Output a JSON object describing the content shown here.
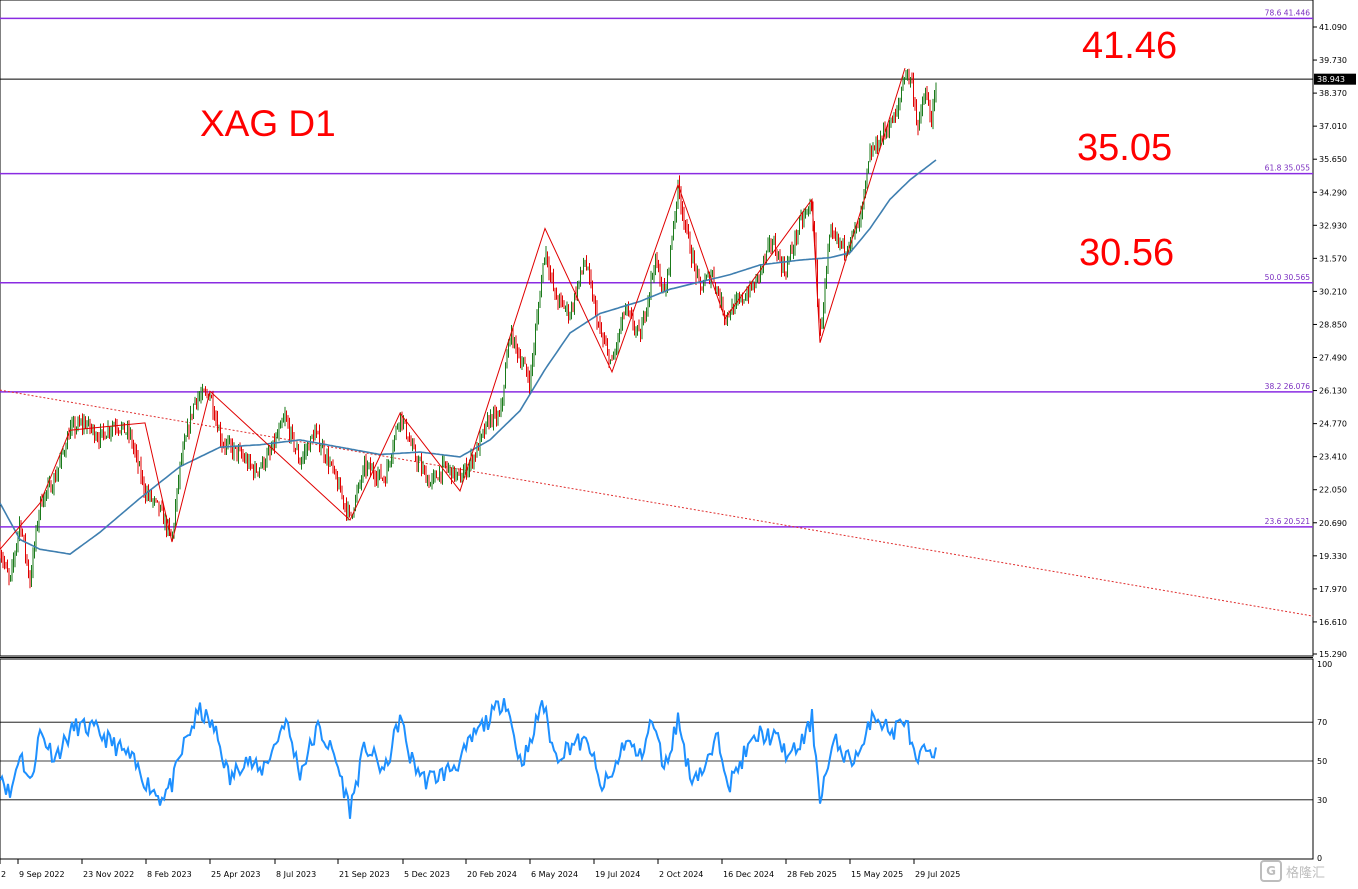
{
  "chart_data": [
    {
      "type": "candlestick",
      "symbol_label": "XAG D1",
      "y_range": [
        15.29,
        42.0
      ],
      "y_ticks": [
        "41.090",
        "39.730",
        "38.370",
        "37.010",
        "35.650",
        "34.290",
        "32.930",
        "31.570",
        "30.210",
        "28.850",
        "27.490",
        "26.130",
        "24.770",
        "23.410",
        "22.050",
        "20.690",
        "19.330",
        "17.970",
        "16.610",
        "15.290"
      ],
      "x_ticks": [
        "2",
        "9 Sep 2022",
        "23 Nov 2022",
        "8 Feb 2023",
        "25 Apr 2023",
        "8 Jul 2023",
        "21 Sep 2023",
        "5 Dec 2023",
        "20 Feb 2024",
        "6 May 2024",
        "19 Jul 2024",
        "2 Oct 2024",
        "16 Dec 2024",
        "28 Feb 2025",
        "15 May 2025",
        "29 Jul 2025"
      ],
      "current_price": "38.943",
      "fib_levels": [
        {
          "label": "78.6 41.446",
          "value": 41.446
        },
        {
          "label": "61.8 35.055",
          "value": 35.055
        },
        {
          "label": "50.0 30.565",
          "value": 30.565
        },
        {
          "label": "38.2 26.076",
          "value": 26.076
        },
        {
          "label": "23.6 20.521",
          "value": 20.521
        }
      ],
      "annotations": [
        "41.46",
        "35.05",
        "30.56"
      ],
      "price_anchors": [
        [
          0,
          19.6
        ],
        [
          10,
          18.2
        ],
        [
          20,
          20.8
        ],
        [
          30,
          18.3
        ],
        [
          40,
          21.5
        ],
        [
          55,
          22.5
        ],
        [
          70,
          24.5
        ],
        [
          85,
          24.8
        ],
        [
          100,
          24.2
        ],
        [
          115,
          24.8
        ],
        [
          130,
          24.3
        ],
        [
          145,
          22.0
        ],
        [
          160,
          21.2
        ],
        [
          172,
          20.0
        ],
        [
          180,
          23.0
        ],
        [
          195,
          25.8
        ],
        [
          210,
          26.0
        ],
        [
          222,
          24.0
        ],
        [
          240,
          23.5
        ],
        [
          255,
          22.8
        ],
        [
          270,
          23.5
        ],
        [
          285,
          25.0
        ],
        [
          300,
          23.2
        ],
        [
          315,
          24.4
        ],
        [
          330,
          23.1
        ],
        [
          350,
          20.9
        ],
        [
          365,
          23.0
        ],
        [
          385,
          22.5
        ],
        [
          400,
          25.2
        ],
        [
          415,
          23.4
        ],
        [
          430,
          22.3
        ],
        [
          445,
          23.0
        ],
        [
          460,
          22.5
        ],
        [
          475,
          23.5
        ],
        [
          490,
          25.0
        ],
        [
          500,
          25.0
        ],
        [
          510,
          28.5
        ],
        [
          520,
          27.5
        ],
        [
          530,
          26.5
        ],
        [
          545,
          32.0
        ],
        [
          555,
          30.0
        ],
        [
          570,
          29.3
        ],
        [
          585,
          31.5
        ],
        [
          600,
          28.5
        ],
        [
          612,
          27.2
        ],
        [
          625,
          29.5
        ],
        [
          640,
          28.3
        ],
        [
          655,
          31.5
        ],
        [
          665,
          30.0
        ],
        [
          678,
          34.5
        ],
        [
          690,
          32.0
        ],
        [
          700,
          30.3
        ],
        [
          712,
          31.0
        ],
        [
          725,
          29.2
        ],
        [
          740,
          29.8
        ],
        [
          755,
          30.5
        ],
        [
          772,
          32.3
        ],
        [
          785,
          31.0
        ],
        [
          800,
          33.0
        ],
        [
          812,
          33.8
        ],
        [
          820,
          28.3
        ],
        [
          830,
          32.5
        ],
        [
          845,
          32.0
        ],
        [
          860,
          33.0
        ],
        [
          870,
          35.8
        ],
        [
          885,
          36.8
        ],
        [
          897,
          37.5
        ],
        [
          905,
          39.3
        ],
        [
          912,
          38.8
        ],
        [
          918,
          36.9
        ],
        [
          925,
          38.4
        ],
        [
          932,
          37.2
        ],
        [
          937,
          38.9
        ]
      ],
      "ma_anchors": [
        [
          0,
          21.5
        ],
        [
          20,
          20.0
        ],
        [
          40,
          19.6
        ],
        [
          70,
          19.4
        ],
        [
          100,
          20.3
        ],
        [
          140,
          21.7
        ],
        [
          180,
          23.0
        ],
        [
          220,
          23.8
        ],
        [
          260,
          23.9
        ],
        [
          300,
          24.1
        ],
        [
          340,
          23.8
        ],
        [
          380,
          23.5
        ],
        [
          420,
          23.6
        ],
        [
          460,
          23.4
        ],
        [
          490,
          24.1
        ],
        [
          520,
          25.3
        ],
        [
          545,
          27.0
        ],
        [
          570,
          28.5
        ],
        [
          600,
          29.3
        ],
        [
          640,
          29.8
        ],
        [
          670,
          30.3
        ],
        [
          700,
          30.6
        ],
        [
          730,
          30.9
        ],
        [
          760,
          31.3
        ],
        [
          800,
          31.5
        ],
        [
          830,
          31.6
        ],
        [
          850,
          31.8
        ],
        [
          870,
          32.8
        ],
        [
          890,
          34.0
        ],
        [
          910,
          34.8
        ],
        [
          937,
          35.65
        ]
      ],
      "trendline": {
        "start": 26.15,
        "end": 16.85,
        "style": "dotted"
      },
      "rsi": {
        "levels": [
          "70",
          "50",
          "30"
        ],
        "y_ticks": [
          "100",
          "0"
        ],
        "anchors": [
          [
            0,
            45
          ],
          [
            10,
            32
          ],
          [
            20,
            55
          ],
          [
            30,
            38
          ],
          [
            40,
            65
          ],
          [
            55,
            52
          ],
          [
            75,
            68
          ],
          [
            95,
            66
          ],
          [
            115,
            58
          ],
          [
            130,
            52
          ],
          [
            145,
            40
          ],
          [
            160,
            31
          ],
          [
            172,
            38
          ],
          [
            185,
            60
          ],
          [
            200,
            76
          ],
          [
            215,
            66
          ],
          [
            230,
            40
          ],
          [
            245,
            52
          ],
          [
            260,
            44
          ],
          [
            275,
            58
          ],
          [
            285,
            72
          ],
          [
            300,
            44
          ],
          [
            318,
            67
          ],
          [
            335,
            52
          ],
          [
            350,
            25
          ],
          [
            365,
            58
          ],
          [
            385,
            44
          ],
          [
            400,
            73
          ],
          [
            410,
            52
          ],
          [
            425,
            40
          ],
          [
            445,
            44
          ],
          [
            460,
            50
          ],
          [
            475,
            64
          ],
          [
            490,
            72
          ],
          [
            505,
            83
          ],
          [
            520,
            50
          ],
          [
            530,
            57
          ],
          [
            542,
            82
          ],
          [
            555,
            52
          ],
          [
            575,
            60
          ],
          [
            590,
            58
          ],
          [
            600,
            36
          ],
          [
            612,
            42
          ],
          [
            625,
            61
          ],
          [
            640,
            52
          ],
          [
            652,
            71
          ],
          [
            665,
            46
          ],
          [
            678,
            72
          ],
          [
            690,
            42
          ],
          [
            705,
            46
          ],
          [
            718,
            62
          ],
          [
            730,
            38
          ],
          [
            745,
            54
          ],
          [
            760,
            64
          ],
          [
            775,
            62
          ],
          [
            790,
            52
          ],
          [
            805,
            62
          ],
          [
            812,
            72
          ],
          [
            820,
            32
          ],
          [
            835,
            60
          ],
          [
            850,
            50
          ],
          [
            865,
            58
          ],
          [
            872,
            76
          ],
          [
            882,
            70
          ],
          [
            892,
            64
          ],
          [
            905,
            73
          ],
          [
            917,
            46
          ],
          [
            925,
            58
          ],
          [
            932,
            48
          ],
          [
            937,
            62
          ]
        ]
      }
    }
  ],
  "watermark": {
    "text": "格隆汇",
    "logo": "G"
  }
}
